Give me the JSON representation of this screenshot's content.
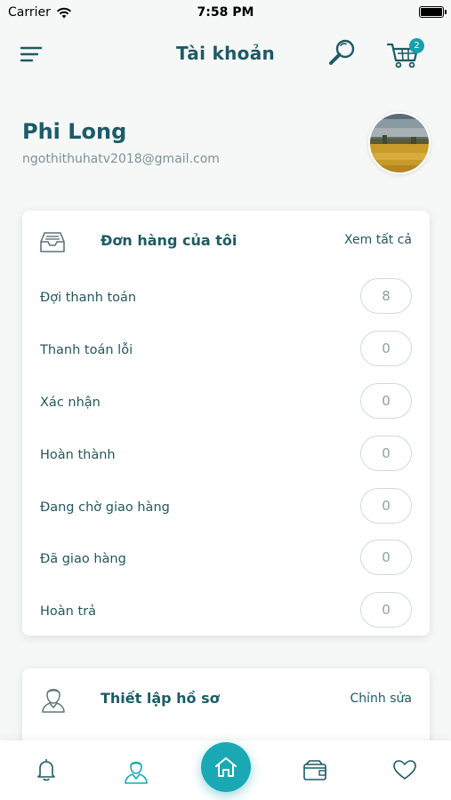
{
  "status_bar": {
    "carrier": "Carrier",
    "time": "7:58 PM"
  },
  "header": {
    "title": "Tài khoản",
    "cart_count": "2"
  },
  "profile": {
    "name": "Phi Long",
    "email": "ngothithuhatv2018@gmail.com"
  },
  "orders": {
    "title": "Đơn hàng của tôi",
    "view_all": "Xem tất cả",
    "items": [
      {
        "label": "Đợi thanh toán",
        "count": "8"
      },
      {
        "label": "Thanh toán lỗi",
        "count": "0"
      },
      {
        "label": "Xác nhận",
        "count": "0"
      },
      {
        "label": "Hoàn thành",
        "count": "0"
      },
      {
        "label": "Đang chờ giao hàng",
        "count": "0"
      },
      {
        "label": "Đã giao hàng",
        "count": "0"
      },
      {
        "label": "Hoàn trả",
        "count": "0"
      }
    ]
  },
  "profile_settings": {
    "title": "Thiết lập hồ sơ",
    "edit": "Chỉnh sửa"
  },
  "colors": {
    "accent": "#1aa9b4",
    "primary_text": "#1d5b66",
    "badge": "#14a1ad"
  },
  "icons": {
    "menu": "menu-icon",
    "search": "search-icon",
    "cart": "cart-icon",
    "orders": "inbox-tray-icon",
    "profile": "user-icon",
    "bell": "bell-icon",
    "user": "user-icon",
    "home": "home-icon",
    "wallet": "wallet-icon",
    "heart": "heart-icon"
  }
}
